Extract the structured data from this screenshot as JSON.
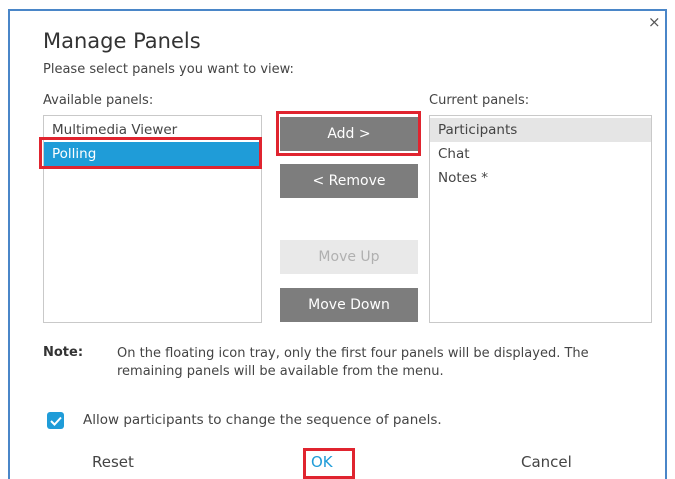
{
  "dialog": {
    "title": "Manage Panels",
    "subtitle": "Please select panels you want to view:",
    "close_glyph": "×"
  },
  "available": {
    "label": "Available panels:",
    "items": [
      "Multimedia Viewer",
      "Polling"
    ],
    "selected": "Polling"
  },
  "current": {
    "label": "Current panels:",
    "items": [
      "Participants",
      "Chat",
      "Notes *"
    ],
    "selected": "Participants"
  },
  "buttons": {
    "add": "Add >",
    "remove": "< Remove",
    "move_up": "Move Up",
    "move_down": "Move Down"
  },
  "note": {
    "label": "Note:",
    "text": "On the floating icon tray, only the first four panels will be displayed. The remaining panels will be available from the menu."
  },
  "option": {
    "checked": true,
    "label": "Allow participants to change the sequence of panels."
  },
  "footer": {
    "reset": "Reset",
    "ok": "OK",
    "cancel": "Cancel"
  },
  "colors": {
    "accent": "#1f9cd8",
    "highlight_box": "#e0242f",
    "button_gray": "#7d7d7d",
    "frame_border": "#4a86c8"
  }
}
